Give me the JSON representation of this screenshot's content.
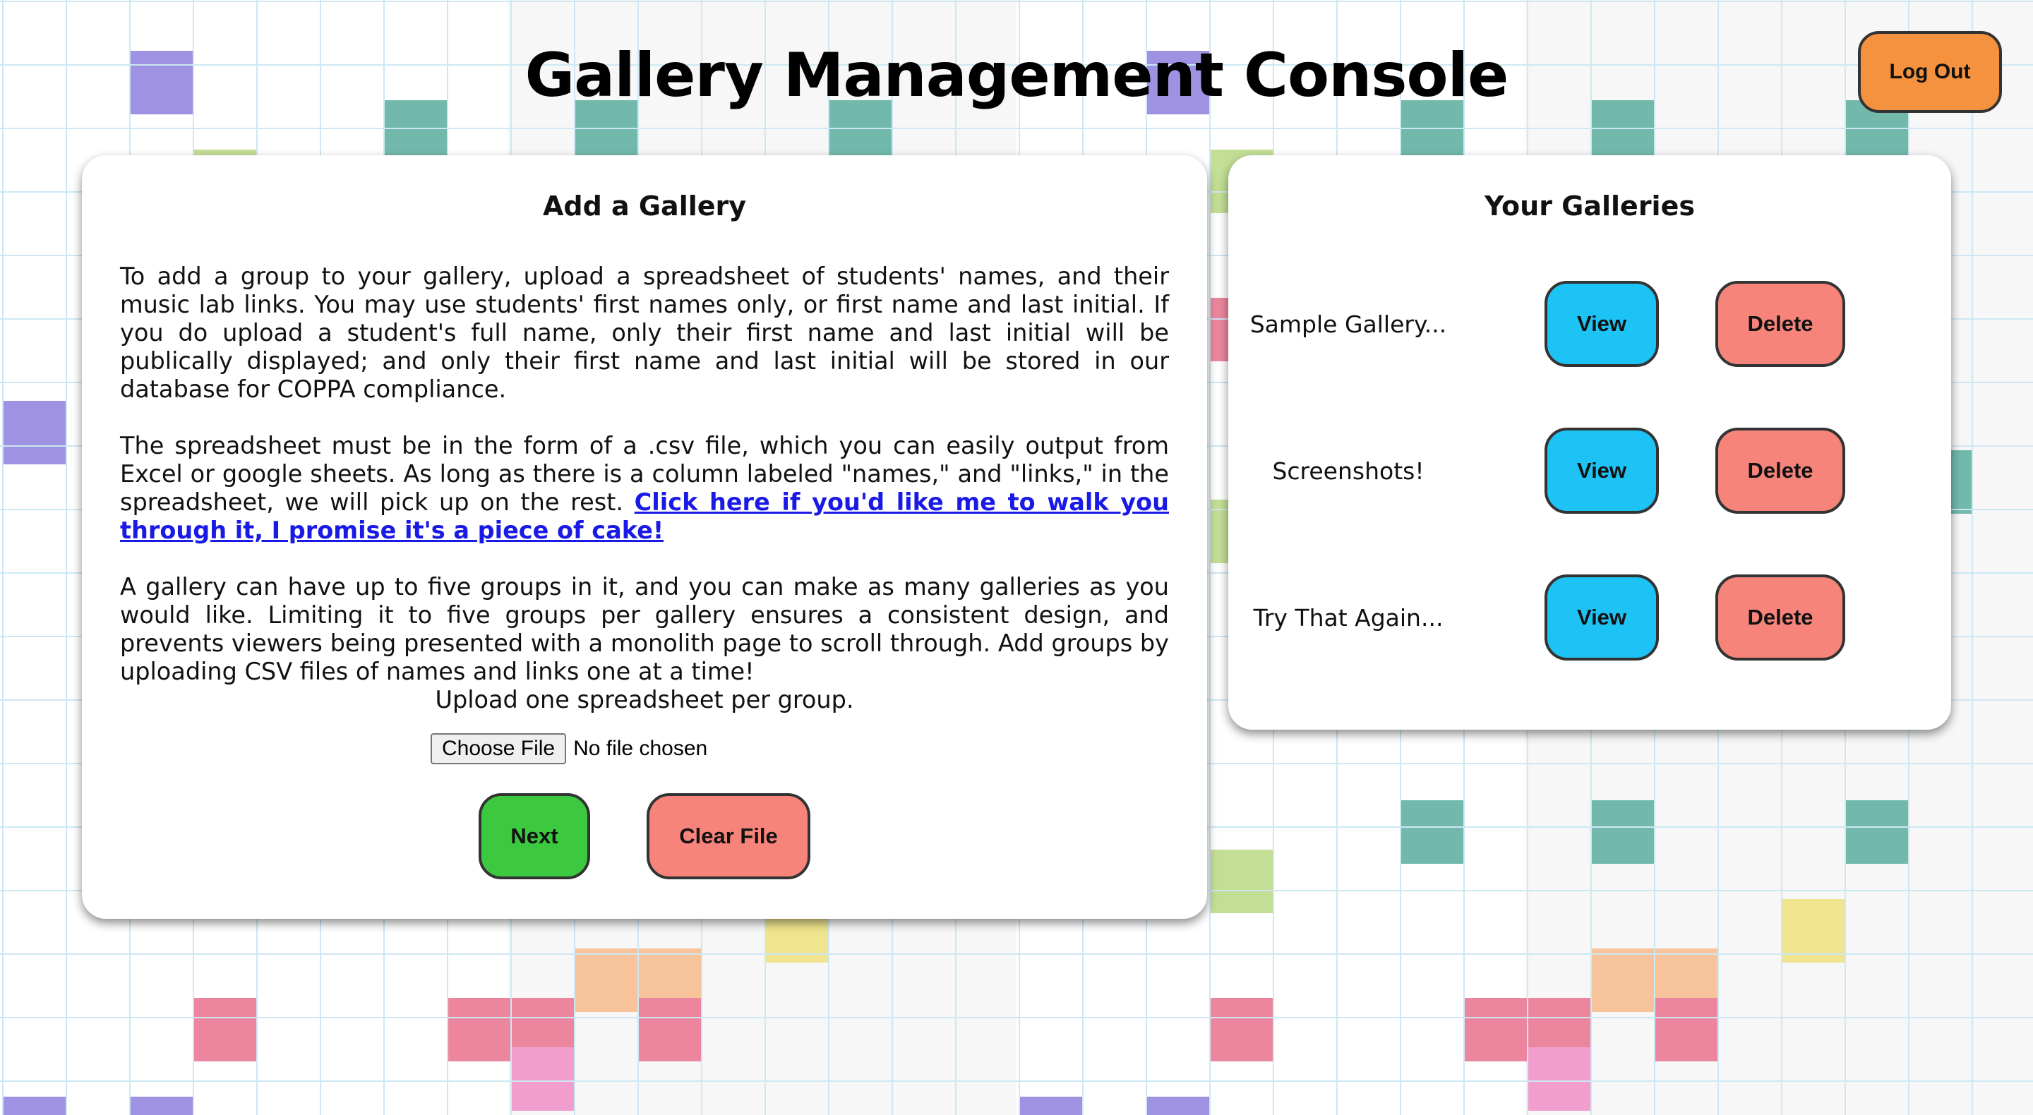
{
  "header": {
    "title": "Gallery Management Console",
    "logout_label": "Log Out"
  },
  "add_gallery": {
    "heading": "Add a Gallery",
    "paragraph1": "To add a group to your gallery, upload a spreadsheet of students' names, and their music lab links. You may use students' first names only, or first name and last initial. If you do upload a student's full name, only their first name and last initial will be publically displayed; and only their first name and last initial will be stored in our database for COPPA compliance.",
    "paragraph2_text": "The spreadsheet must be in the form of a .csv file, which you can easily output from Excel or google sheets. As long as there is a column labeled \"names,\" and \"links,\" in the spreadsheet, we will pick up on the rest.",
    "paragraph2_link": "Click here if you'd like me to walk you through it, I promise it's a piece of cake!",
    "paragraph3": "A gallery can have up to five groups in it, and you can make as many galleries as you would like. Limiting it to five groups per gallery ensures a consistent design, and prevents viewers being presented with a monolith page to scroll through. Add groups by uploading CSV files of names and links one at a time!",
    "upload_label": "Upload one spreadsheet per group.",
    "choose_file_label": "Choose File",
    "file_status": "No file chosen",
    "next_label": "Next",
    "clear_label": "Clear File"
  },
  "galleries": {
    "heading": "Your Galleries",
    "items": [
      {
        "name": "Sample Gallery...",
        "view_label": "View",
        "delete_label": "Delete"
      },
      {
        "name": "Screenshots!",
        "view_label": "View",
        "delete_label": "Delete"
      },
      {
        "name": "Try That Again...",
        "view_label": "View",
        "delete_label": "Delete"
      }
    ]
  },
  "colors": {
    "logout": "#f5923f",
    "next": "#3cc93f",
    "clear": "#f6847a",
    "view": "#1ec3f5",
    "delete": "#f6847a",
    "link": "#1a1ae6",
    "grid_line": "#cde8f4"
  }
}
